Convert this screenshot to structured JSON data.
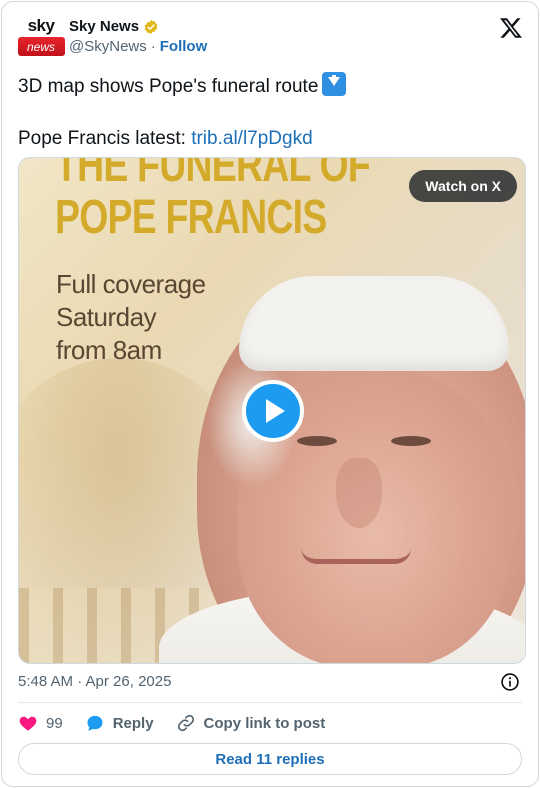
{
  "account": {
    "avatar_top": "sky",
    "avatar_bottom": "news",
    "display_name": "Sky News",
    "handle": "@SkyNews",
    "separator": "·",
    "follow_label": "Follow"
  },
  "tweet": {
    "line1": "3D map shows Pope's funeral route",
    "line2_prefix": "Pope Francis latest:",
    "link_text": "trib.al/l7pDgkd"
  },
  "media": {
    "title_line1": "THE FUNERAL OF",
    "title_line2": "POPE FRANCIS",
    "coverage_line1": "Full coverage",
    "coverage_line2": "Saturday",
    "coverage_line3": "from 8am",
    "watch_label": "Watch on X"
  },
  "meta": {
    "timestamp": "5:48 AM · Apr 26, 2025"
  },
  "actions": {
    "likes_count": "99",
    "reply_label": "Reply",
    "copy_label": "Copy link to post",
    "read_replies_label": "Read 11 replies"
  },
  "colors": {
    "link": "#1d6fb8",
    "like": "#f91880",
    "reply_icon": "#1d9bf0",
    "verified": "#e2b719",
    "brand_red": "#e8252b"
  },
  "icons": {
    "x_logo": "x-logo-icon",
    "verified": "verified-badge-icon",
    "info": "info-icon",
    "heart": "heart-icon",
    "reply": "reply-bubble-icon",
    "copy": "link-icon",
    "play": "play-icon",
    "down_arrow": "down-arrow-emoji-icon"
  }
}
